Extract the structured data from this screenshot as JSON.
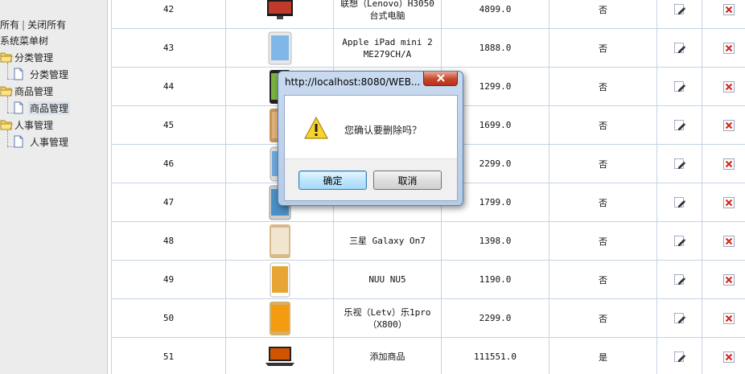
{
  "tree": {
    "expand_all": "所有",
    "separator": "|",
    "collapse_all": "关闭所有",
    "root_label": "系统菜单树",
    "nodes": [
      {
        "label": "分类管理",
        "children": [
          {
            "label": "分类管理"
          }
        ]
      },
      {
        "label": "商品管理",
        "children": [
          {
            "label": "商品管理",
            "selected": true
          }
        ]
      },
      {
        "label": "人事管理",
        "children": [
          {
            "label": "人事管理"
          }
        ]
      }
    ]
  },
  "grid": {
    "rows": [
      {
        "id": "42",
        "name": "联想（Lenovo）H3050 台式电脑",
        "price": "4899.0",
        "hot": "否"
      },
      {
        "id": "43",
        "name": "Apple iPad mini 2 ME279CH/A",
        "price": "1888.0",
        "hot": "否"
      },
      {
        "id": "44",
        "name": "",
        "price": "1299.0",
        "hot": "否"
      },
      {
        "id": "45",
        "name": "",
        "price": "1699.0",
        "hot": "否"
      },
      {
        "id": "46",
        "name": "",
        "price": "2299.0",
        "hot": "否"
      },
      {
        "id": "47",
        "name": "",
        "price": "1799.0",
        "hot": "否"
      },
      {
        "id": "48",
        "name": "三星 Galaxy On7",
        "price": "1398.0",
        "hot": "否"
      },
      {
        "id": "49",
        "name": "NUU NU5",
        "price": "1190.0",
        "hot": "否"
      },
      {
        "id": "50",
        "name": "乐视（Letv）乐1pro（X800）",
        "price": "2299.0",
        "hot": "否"
      },
      {
        "id": "51",
        "name": "添加商品",
        "price": "111551.0",
        "hot": "是"
      }
    ]
  },
  "dialog": {
    "title": "http://localhost:8080/WEB...",
    "message": "您确认要删除吗？",
    "ok_label": "确定",
    "cancel_label": "取消"
  },
  "colors": {
    "grid_border": "#c4d3e3",
    "panel_bg": "#ececec",
    "close_button": "#c7462b"
  }
}
